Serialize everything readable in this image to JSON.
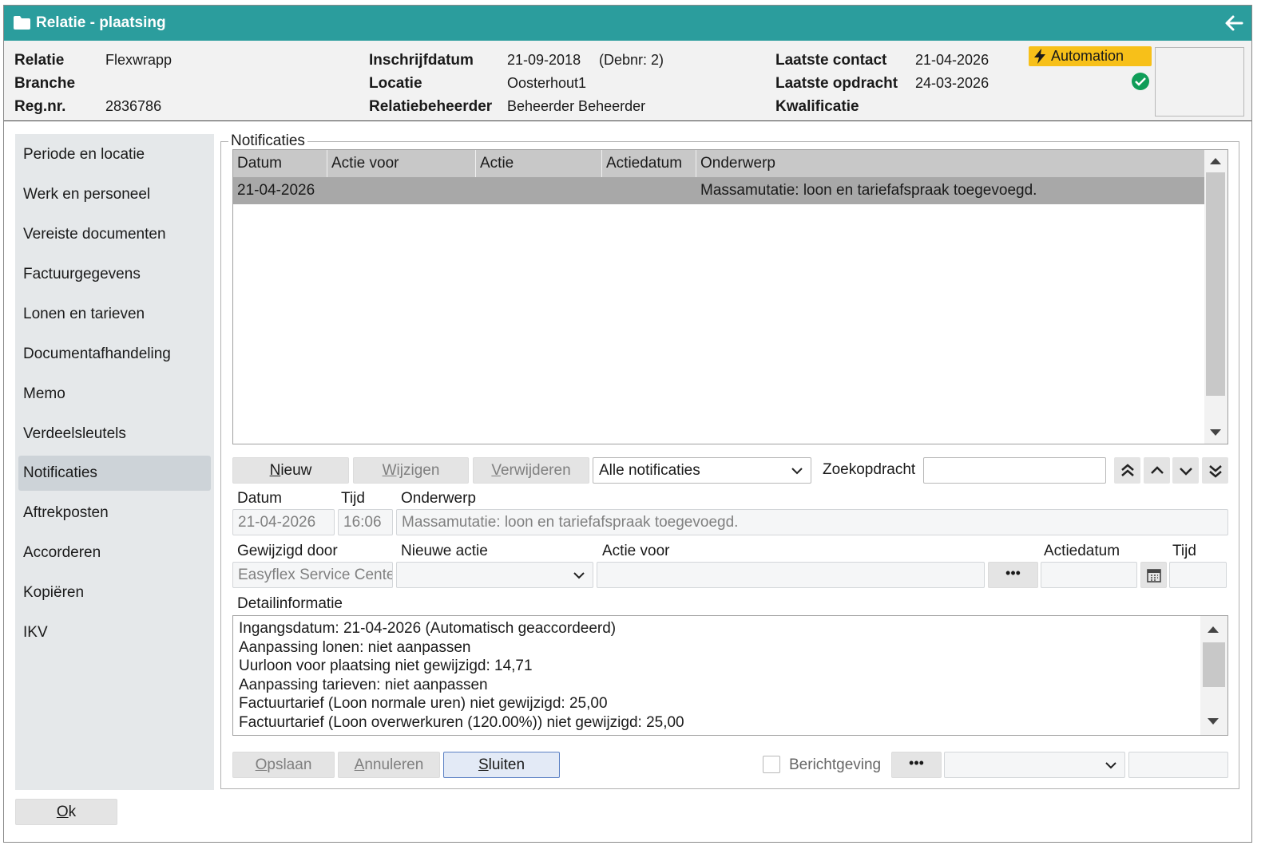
{
  "window": {
    "title": "Relatie - plaatsing"
  },
  "header": {
    "relatie_label": "Relatie",
    "relatie": "Flexwrapp",
    "branche_label": "Branche",
    "branche": "",
    "regnr_label": "Reg.nr.",
    "regnr": "2836786",
    "inschrijfdatum_label": "Inschrijfdatum",
    "inschrijfdatum": "21-09-2018",
    "debnr": "(Debnr: 2)",
    "locatie_label": "Locatie",
    "locatie": "Oosterhout1",
    "relatiebeheerder_label": "Relatiebeheerder",
    "relatiebeheerder": "Beheerder Beheerder",
    "laatste_contact_label": "Laatste contact",
    "laatste_contact": "21-04-2026",
    "laatste_opdracht_label": "Laatste opdracht",
    "laatste_opdracht": "24-03-2026",
    "kwalificatie_label": "Kwalificatie",
    "kwalificatie": "",
    "automation_badge": "Automation"
  },
  "sidebar": {
    "items": [
      {
        "label": "Periode en locatie"
      },
      {
        "label": "Werk en personeel"
      },
      {
        "label": "Vereiste documenten"
      },
      {
        "label": "Factuurgegevens"
      },
      {
        "label": "Lonen en tarieven"
      },
      {
        "label": "Documentafhandeling"
      },
      {
        "label": "Memo"
      },
      {
        "label": "Verdeelsleutels"
      },
      {
        "label": "Notificaties"
      },
      {
        "label": "Aftrekposten"
      },
      {
        "label": "Accorderen"
      },
      {
        "label": "Kopiëren"
      },
      {
        "label": "IKV"
      }
    ],
    "active": "Notificaties"
  },
  "notificaties": {
    "group_title": "Notificaties",
    "columns": [
      "Datum",
      "Actie voor",
      "Actie",
      "Actiedatum",
      "Onderwerp"
    ],
    "rows": [
      {
        "datum": "21-04-2026",
        "actie_voor": "",
        "actie": "",
        "actiedatum": "",
        "onderwerp": "Massamutatie: loon en tariefafspraak toegevoegd."
      }
    ]
  },
  "toolbar": {
    "nieuw_u": "N",
    "nieuw_rest": "ieuw",
    "wijzigen_u": "W",
    "wijzigen_rest": "ijzigen",
    "verwijderen_u": "V",
    "verwijderen_rest": "erwijderen",
    "filter_value": "Alle notificaties",
    "zoek_label": "Zoekopdracht",
    "zoek_value": ""
  },
  "form": {
    "datum_label": "Datum",
    "datum": "21-04-2026",
    "tijd_label": "Tijd",
    "tijd": "16:06",
    "onderwerp_label": "Onderwerp",
    "onderwerp": "Massamutatie: loon en tariefafspraak toegevoegd.",
    "gewijzigd_door_label": "Gewijzigd door",
    "gewijzigd_door": "Easyflex Service Cente",
    "nieuwe_actie_label": "Nieuwe actie",
    "nieuwe_actie": "",
    "actie_voor_label": "Actie voor",
    "actie_voor": "",
    "actiedatum_label": "Actiedatum",
    "actiedatum": "",
    "tijd2_label": "Tijd",
    "tijd2": "",
    "detail_label": "Detailinformatie",
    "detail_lines": [
      "Ingangsdatum: 21-04-2026 (Automatisch geaccordeerd)",
      "Aanpassing lonen: niet aanpassen",
      "Uurloon voor plaatsing niet gewijzigd: 14,71",
      "Aanpassing tarieven: niet aanpassen",
      "Factuurtarief (Loon normale uren) niet gewijzigd: 25,00",
      "Factuurtarief (Loon overwerkuren (120.00%)) niet gewijzigd: 25,00"
    ]
  },
  "footer": {
    "opslaan_u": "O",
    "opslaan_rest": "pslaan",
    "annuleren_u": "A",
    "annuleren_rest": "nnuleren",
    "sluiten_u": "S",
    "sluiten_rest": "luiten",
    "berichtgeving_label": "Berichtgeving",
    "ok_u": "O",
    "ok_rest": "k"
  },
  "colors": {
    "titlebar": "#2b9d9d",
    "automation": "#f7c019",
    "check": "#0f9d58"
  },
  "icons": [
    "folder-icon",
    "back-arrow-icon",
    "bolt-icon",
    "check-circle-icon",
    "chevron-down-icon",
    "calendar-icon",
    "ellipsis-icon",
    "first-icon",
    "prev-icon",
    "next-icon",
    "last-icon"
  ]
}
